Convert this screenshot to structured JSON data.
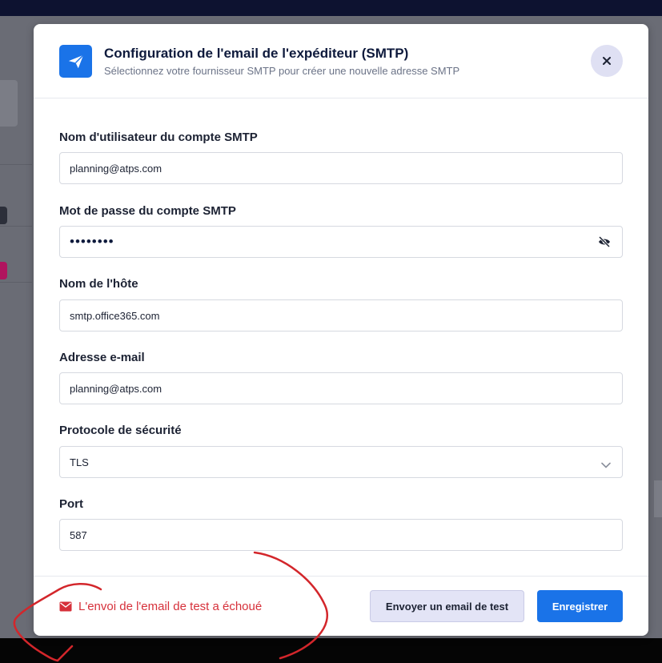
{
  "modal": {
    "title": "Configuration de l'email de l'expéditeur (SMTP)",
    "subtitle": "Sélectionnez votre fournisseur SMTP pour créer une nouvelle adresse SMTP"
  },
  "form": {
    "username": {
      "label": "Nom d'utilisateur du compte SMTP",
      "value": "planning@atps.com"
    },
    "password": {
      "label": "Mot de passe du compte SMTP",
      "value": "••••••••"
    },
    "host": {
      "label": "Nom de l'hôte",
      "value": "smtp.office365.com"
    },
    "email": {
      "label": "Adresse e-mail",
      "value": "planning@atps.com"
    },
    "protocol": {
      "label": "Protocole de sécurité",
      "value": "TLS"
    },
    "port": {
      "label": "Port",
      "value": "587"
    }
  },
  "footer": {
    "error_message": "L'envoi de l'email de test a échoué",
    "test_button": "Envoyer un email de test",
    "save_button": "Enregistrer"
  },
  "colors": {
    "accent": "#1a73e8",
    "error": "#d6303a",
    "annotation": "#d3262b"
  },
  "icons": {
    "logo": "paper-plane-icon",
    "close": "close-icon",
    "password_toggle": "eye-slash-icon",
    "select_arrow": "chevron-down-icon",
    "error": "envelope-icon"
  }
}
